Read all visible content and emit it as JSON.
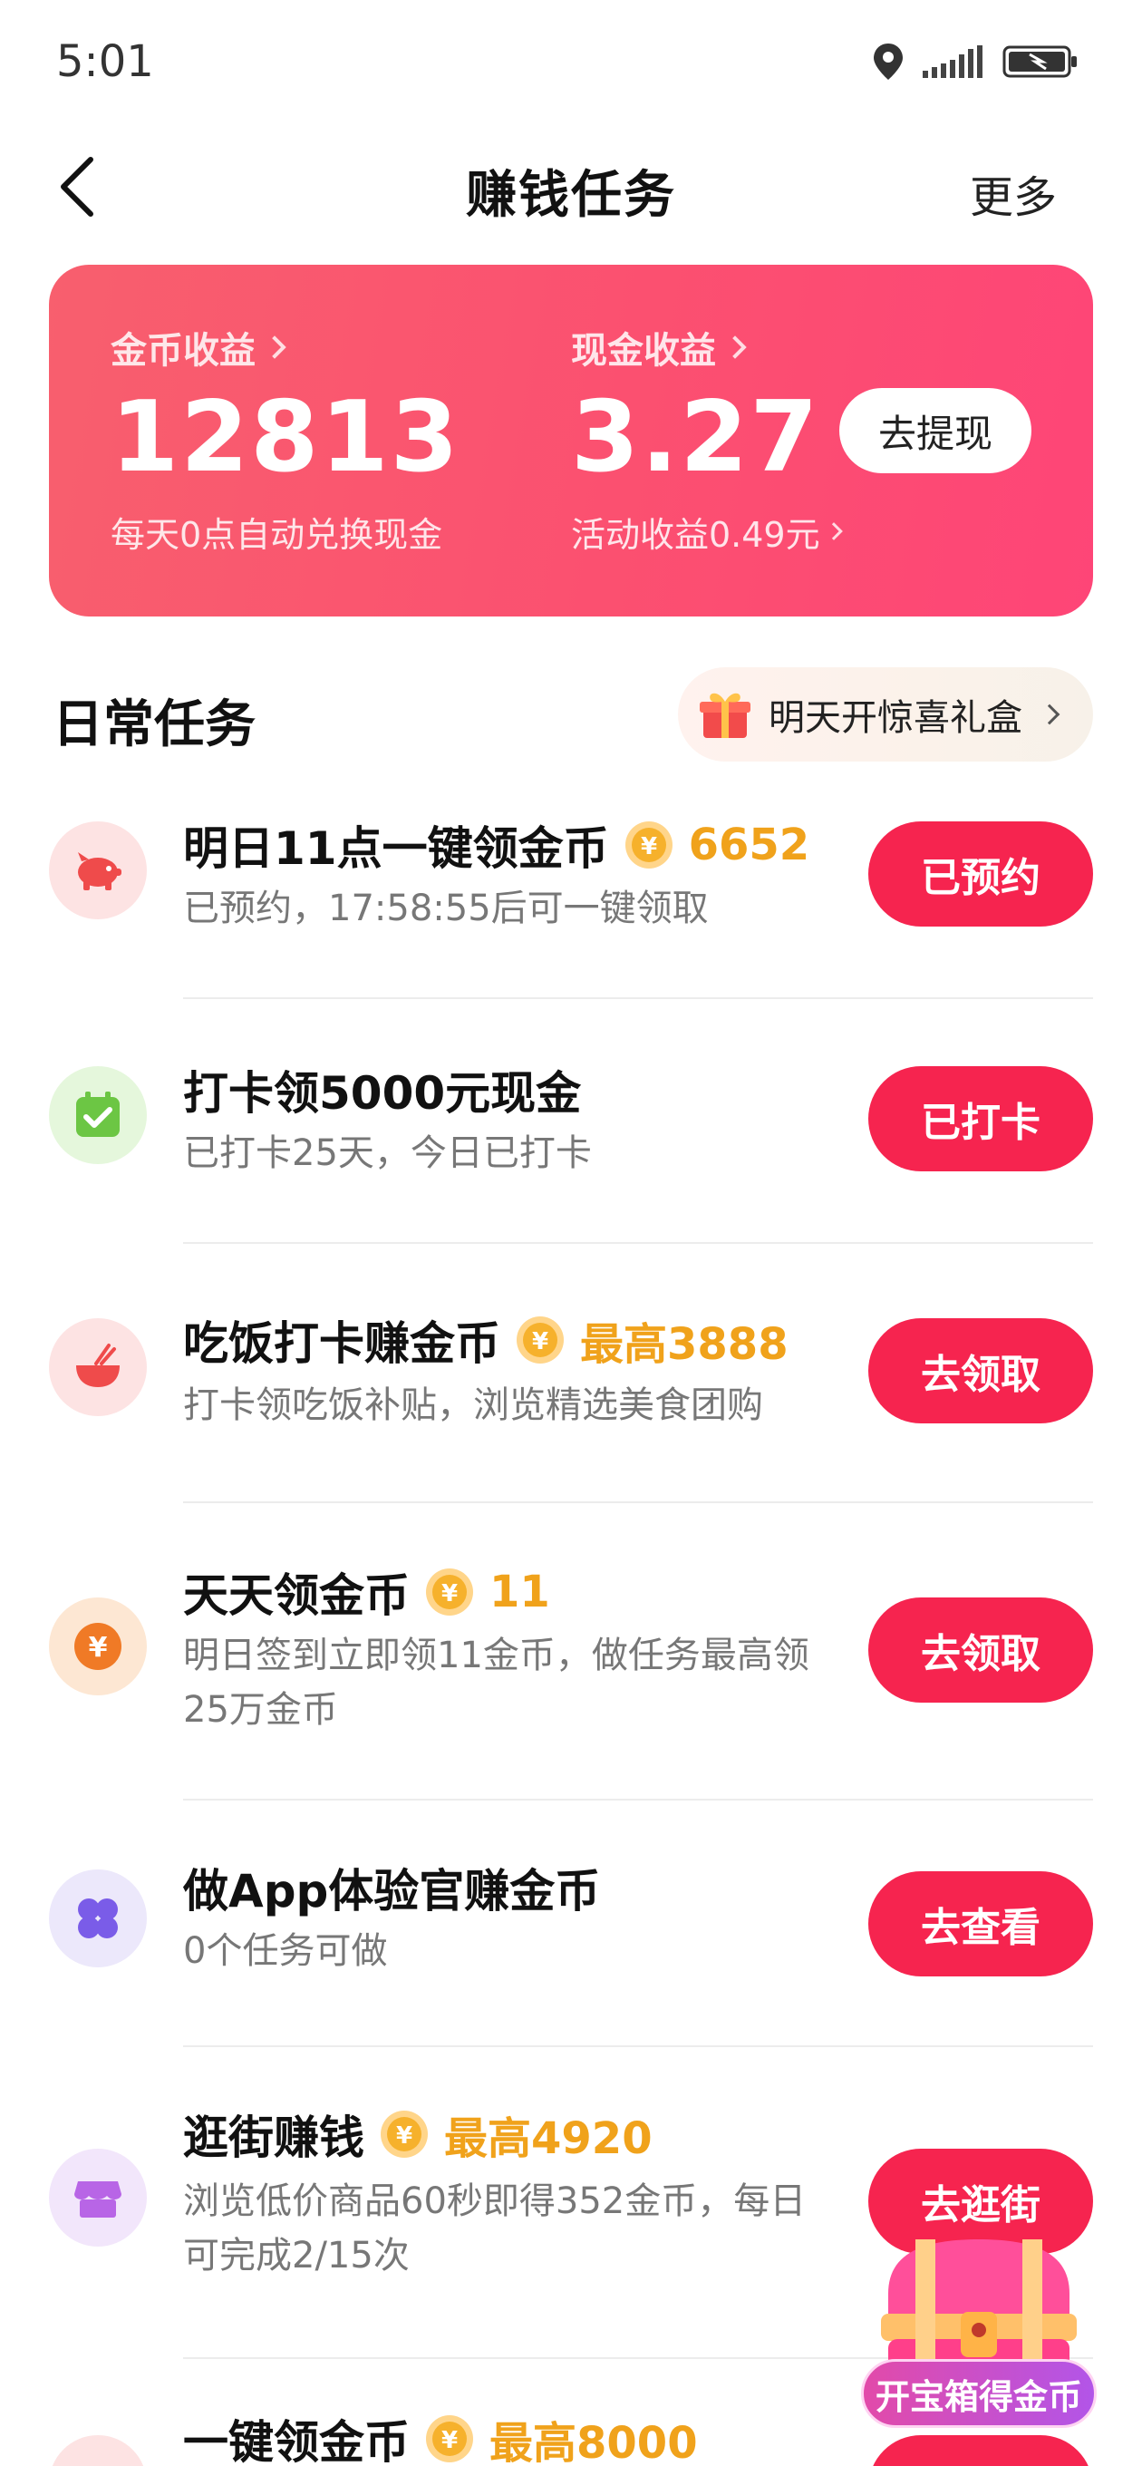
{
  "status": {
    "time": "5:01"
  },
  "nav": {
    "title": "赚钱任务",
    "more": "更多"
  },
  "earnings": {
    "coins_label": "金币收益",
    "coins_value": "12813",
    "coins_sub": "每天0点自动兑换现金",
    "cash_label": "现金收益",
    "cash_value": "3.27",
    "cash_sub": "活动收益0.49元",
    "withdraw": "去提现"
  },
  "section": {
    "title": "日常任务",
    "giftbox": "明天开惊喜礼盒"
  },
  "tasks": [
    {
      "title": "明日11点一键领金币",
      "reward": "6652",
      "desc": "已预约，17:58:55后可一键领取",
      "button": "已预约",
      "icon": "piggy-bank-icon"
    },
    {
      "title": "打卡领5000元现金",
      "reward": "",
      "desc": "已打卡25天，今日已打卡",
      "button": "已打卡",
      "icon": "calendar-check-icon"
    },
    {
      "title": "吃饭打卡赚金币",
      "reward": "最高3888",
      "desc": "打卡领吃饭补贴，浏览精选美食团购",
      "button": "去领取",
      "icon": "rice-bowl-icon"
    },
    {
      "title": "天天领金币",
      "reward": "11",
      "desc": "明日签到立即领11金币，做任务最高领25万金币",
      "button": "去领取",
      "icon": "yuan-coin-icon"
    },
    {
      "title": "做App体验官赚金币",
      "reward": "",
      "desc": "0个任务可做",
      "button": "去查看",
      "icon": "clover-icon"
    },
    {
      "title": "逛街赚钱",
      "reward": "最高4920",
      "desc": "浏览低价商品60秒即得352金币，每日可完成2/15次",
      "button": "去逛街",
      "icon": "shop-icon"
    },
    {
      "title": "一键领金币",
      "reward": "最高8000",
      "desc": "",
      "button": "",
      "icon": "gift-red-icon"
    }
  ],
  "treasure": {
    "label": "开宝箱得金币"
  },
  "colors": {
    "accent": "#f6244f",
    "reward": "#f0a21b",
    "card_start": "#f85f6e",
    "card_end": "#fe4577"
  }
}
